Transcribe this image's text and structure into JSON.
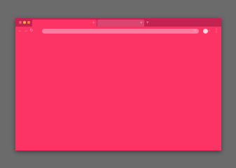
{
  "tabs": [
    {
      "label": "",
      "close": "×"
    },
    {
      "label": "",
      "close": "×"
    }
  ],
  "new_tab": "+",
  "nav": {
    "back": "←",
    "forward": "→",
    "reload": "↻"
  },
  "omnibox": {
    "placeholder": "",
    "star": "☆"
  },
  "toolbar": {
    "extensions": "›",
    "menu": "⋮"
  },
  "colors": {
    "frame": "#c22350",
    "page": "#fc3465",
    "omnibox": "#fd7da0",
    "backdrop": "#6b6b6b"
  }
}
